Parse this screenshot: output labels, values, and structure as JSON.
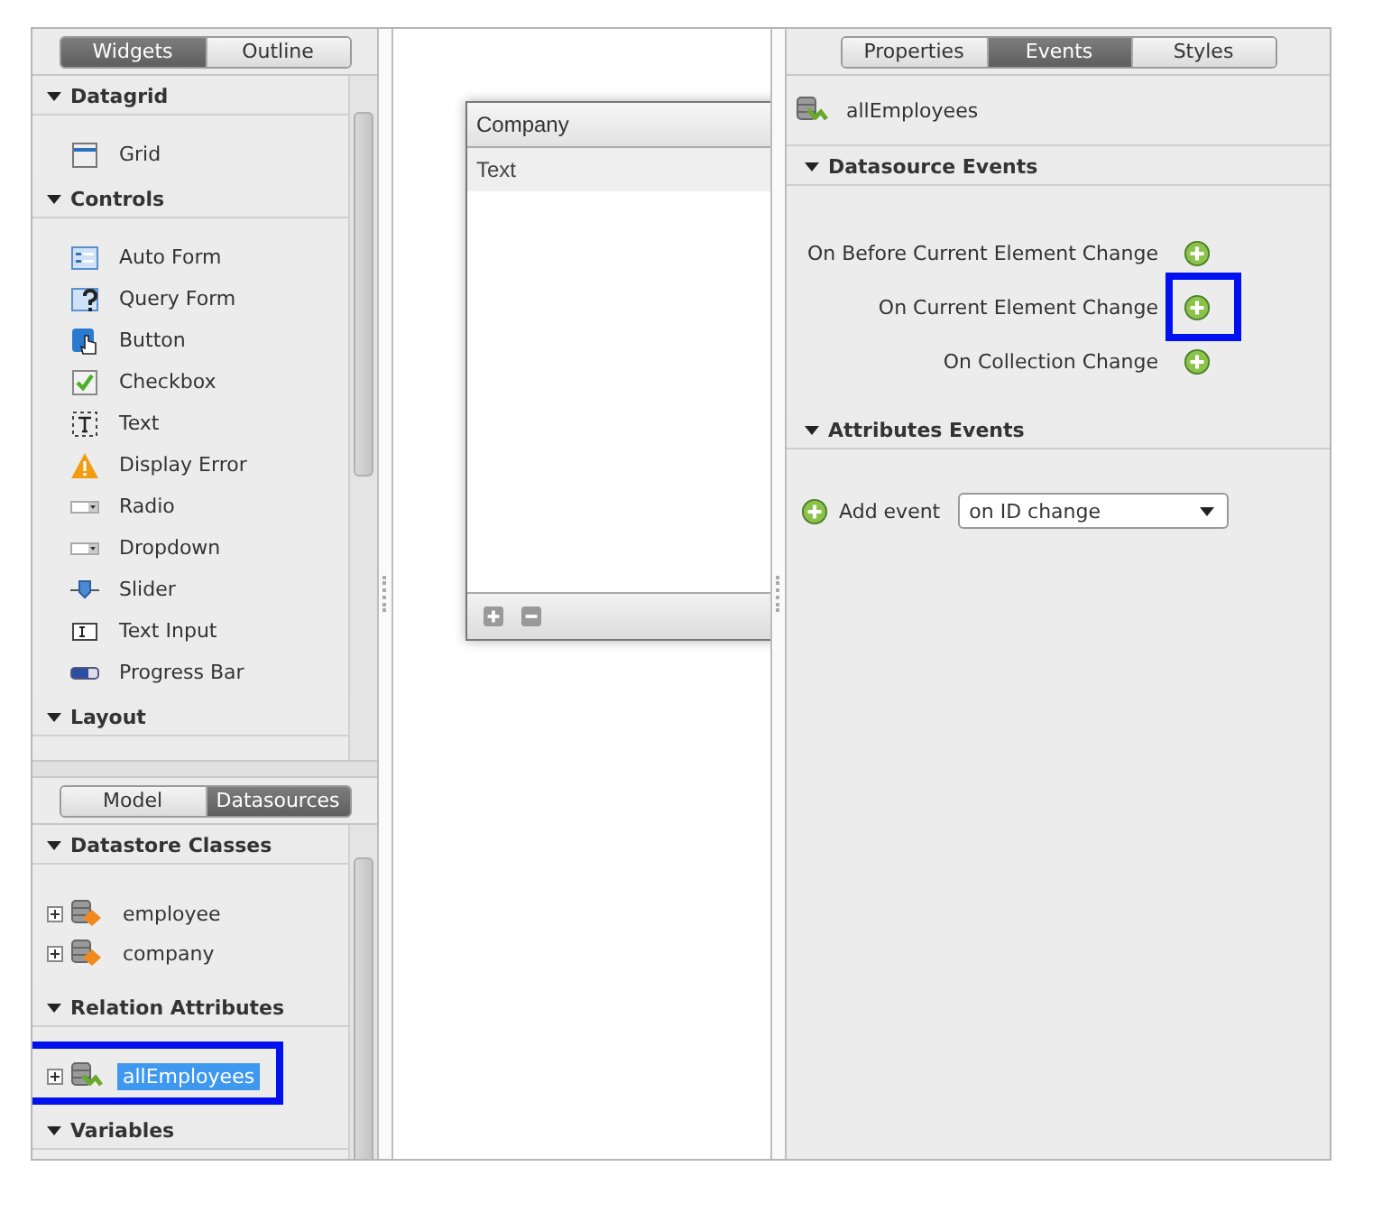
{
  "widgets_panel": {
    "tabs": [
      {
        "label": "Widgets",
        "selected": true
      },
      {
        "label": "Outline",
        "selected": false
      }
    ],
    "sections": [
      {
        "title": "Datagrid",
        "expanded": true,
        "items": [
          "Grid"
        ]
      },
      {
        "title": "Controls",
        "expanded": true,
        "items": [
          "Auto Form",
          "Query Form",
          "Button",
          "Checkbox",
          "Text",
          "Display Error",
          "Radio",
          "Dropdown",
          "Slider",
          "Text Input",
          "Progress Bar"
        ]
      },
      {
        "title": "Layout",
        "expanded": true
      }
    ]
  },
  "datasources_panel": {
    "tabs": [
      {
        "label": "Model",
        "selected": false
      },
      {
        "label": "Datasources",
        "selected": true
      }
    ],
    "sections": [
      {
        "title": "Datastore Classes",
        "expanded": true,
        "items": [
          {
            "label": "employee",
            "expanded": false,
            "selected": false,
            "highlighted": false
          },
          {
            "label": "company",
            "expanded": false,
            "selected": false,
            "highlighted": false
          }
        ]
      },
      {
        "title": "Relation Attributes",
        "expanded": true,
        "items": [
          {
            "label": "allEmployees",
            "expanded": false,
            "selected": true,
            "highlighted": true
          }
        ]
      },
      {
        "title": "Variables",
        "expanded": true
      }
    ]
  },
  "canvas": {
    "grid": {
      "title": "Company",
      "columns": [
        "Text"
      ]
    }
  },
  "inspector": {
    "tabs": [
      {
        "label": "Properties",
        "selected": false
      },
      {
        "label": "Events",
        "selected": true
      },
      {
        "label": "Styles",
        "selected": false
      }
    ],
    "datasource": "allEmployees",
    "datasource_events": {
      "title": "Datasource Events",
      "expanded": true,
      "events": [
        {
          "label": "On Before Current Element Change",
          "highlighted": false
        },
        {
          "label": "On Current Element Change",
          "highlighted": true
        },
        {
          "label": "On Collection Change",
          "highlighted": false
        }
      ]
    },
    "attribute_events": {
      "title": "Attributes Events",
      "expanded": true,
      "add_label": "Add event",
      "dropdown": "on ID change"
    }
  }
}
